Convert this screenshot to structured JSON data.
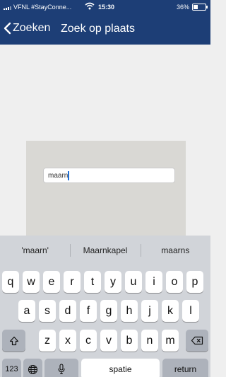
{
  "status_bar": {
    "carrier": "VFNL #StayConne...",
    "time": "15:30",
    "battery_percent": "36%",
    "battery_level": 0.36,
    "signal_icon": "signal-bars-icon",
    "wifi_icon": "wifi-icon",
    "battery_icon": "battery-icon"
  },
  "nav": {
    "back_label": "Zoeken",
    "back_icon": "chevron-left-icon",
    "title": "Zoek op plaats"
  },
  "search": {
    "value": "maarn"
  },
  "keyboard": {
    "suggestions": [
      "'maarn'",
      "Maarnkapel",
      "maarns"
    ],
    "row1": [
      "q",
      "w",
      "e",
      "r",
      "t",
      "y",
      "u",
      "i",
      "o",
      "p"
    ],
    "row2": [
      "a",
      "s",
      "d",
      "f",
      "g",
      "h",
      "j",
      "k",
      "l"
    ],
    "row3": [
      "z",
      "x",
      "c",
      "v",
      "b",
      "n",
      "m"
    ],
    "numbers_label": "123",
    "space_label": "spatie",
    "return_label": "return",
    "shift_icon": "shift-icon",
    "delete_icon": "backspace-icon",
    "globe_icon": "globe-icon",
    "mic_icon": "microphone-icon"
  },
  "colors": {
    "header_bg": "#1d3e76",
    "keyboard_bg": "#d1d4d9",
    "panel_bg": "#d9d8d4",
    "caret": "#1d6fd8"
  }
}
